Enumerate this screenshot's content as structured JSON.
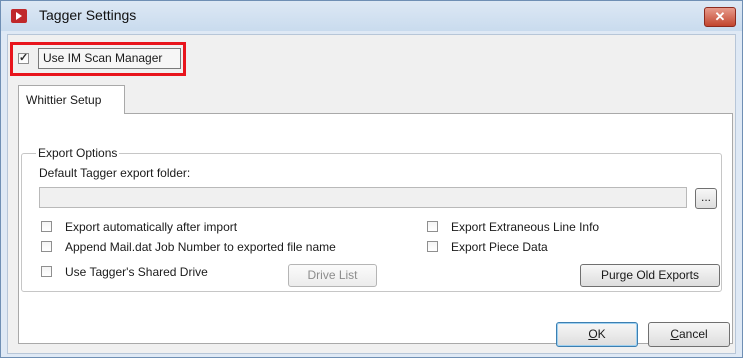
{
  "window": {
    "title": "Tagger Settings",
    "close_label": "✕"
  },
  "top": {
    "use_im_scan_manager": {
      "label": "Use IM Scan Manager",
      "checked": true
    }
  },
  "tabs": [
    {
      "label": "Whittier Setup",
      "selected": true
    }
  ],
  "export_options": {
    "legend": "Export Options",
    "folder_label": "Default Tagger export folder:",
    "folder_value": "",
    "browse_label": "...",
    "checkboxes": {
      "export_auto": {
        "label": "Export automatically after import",
        "checked": false
      },
      "append_job": {
        "label": "Append Mail.dat Job Number to exported file name",
        "checked": false
      },
      "shared_drive": {
        "label": "Use Tagger's Shared Drive",
        "checked": false
      },
      "extraneous": {
        "label": "Export Extraneous Line Info",
        "checked": false
      },
      "piece_data": {
        "label": "Export Piece Data",
        "checked": false
      }
    },
    "drive_list_label": "Drive List",
    "purge_label": "Purge Old Exports"
  },
  "footer": {
    "ok_key": "O",
    "ok_rest": "K",
    "cancel_key": "C",
    "cancel_rest": "ancel"
  }
}
